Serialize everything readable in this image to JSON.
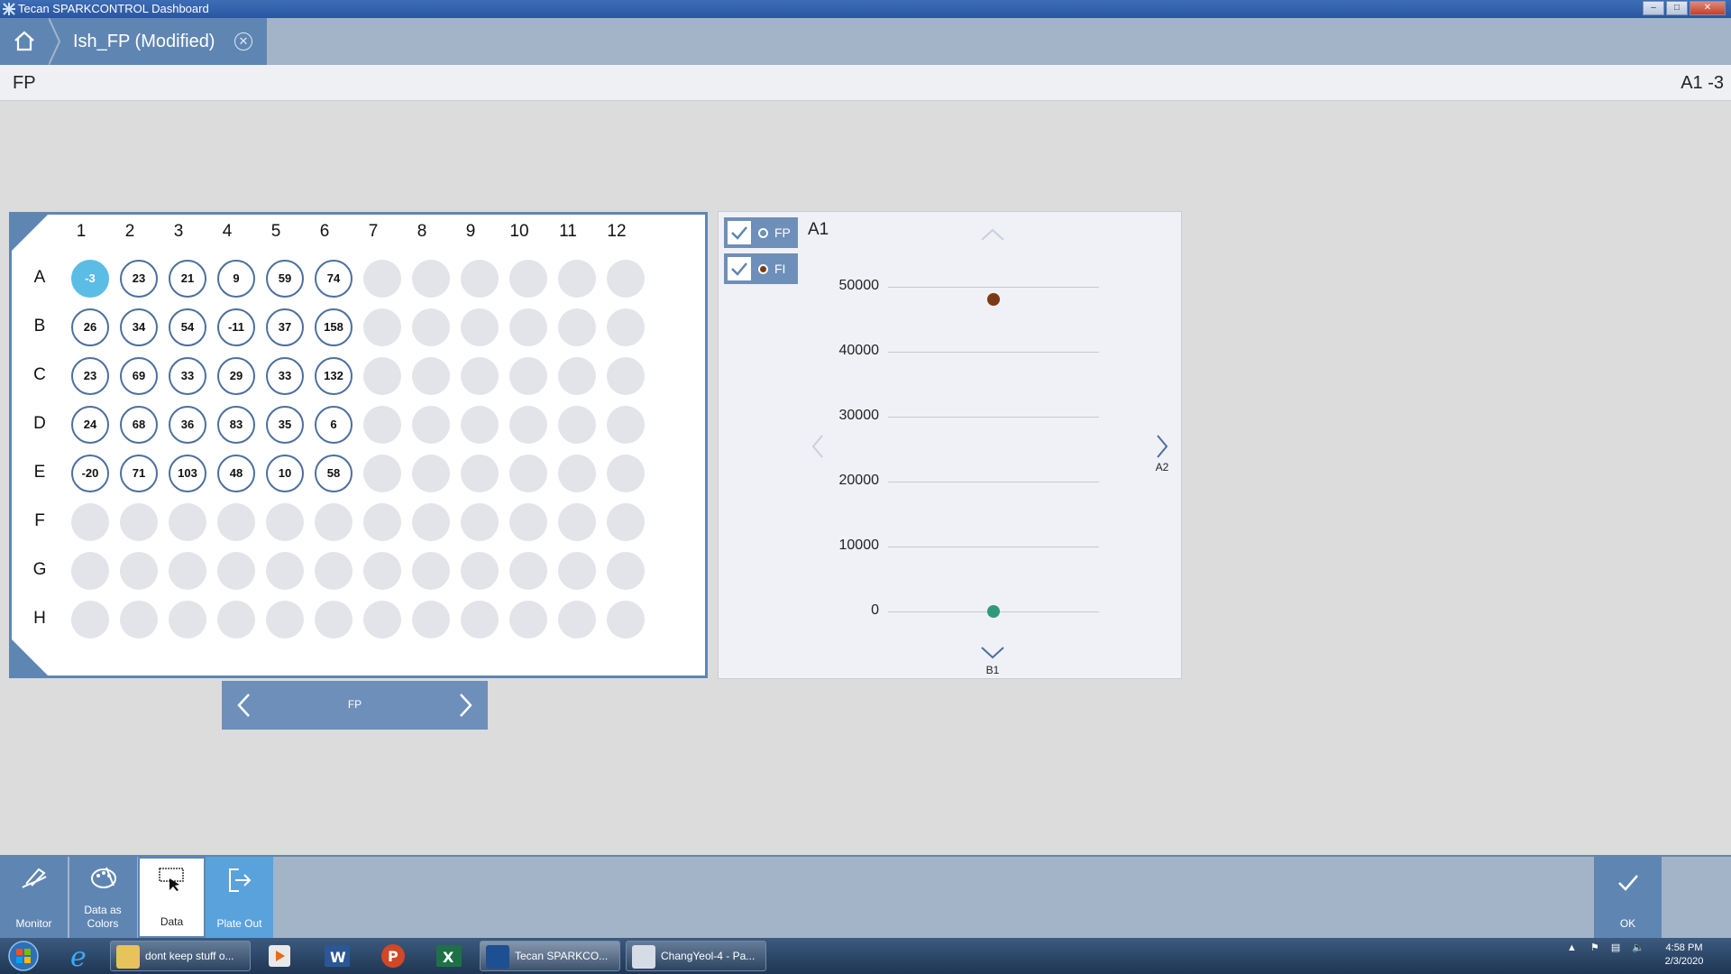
{
  "window": {
    "title": "Tecan SPARKCONTROL Dashboard"
  },
  "tab": {
    "label": "Ish_FP (Modified)"
  },
  "header": {
    "left": "FP",
    "right": "A1 -3"
  },
  "plate": {
    "columns": [
      "1",
      "2",
      "3",
      "4",
      "5",
      "6",
      "7",
      "8",
      "9",
      "10",
      "11",
      "12"
    ],
    "rows": [
      "A",
      "B",
      "C",
      "D",
      "E",
      "F",
      "G",
      "H"
    ],
    "values": [
      [
        "-3",
        "23",
        "21",
        "9",
        "59",
        "74"
      ],
      [
        "26",
        "34",
        "54",
        "-11",
        "37",
        "158"
      ],
      [
        "23",
        "69",
        "33",
        "29",
        "33",
        "132"
      ],
      [
        "24",
        "68",
        "36",
        "83",
        "35",
        "6"
      ],
      [
        "-20",
        "71",
        "103",
        "48",
        "10",
        "58"
      ]
    ],
    "selected_well": "A1",
    "nav_label": "FP"
  },
  "chart_panel": {
    "well": "A1",
    "checkboxes": [
      {
        "label": "FP",
        "checked": true,
        "color": "#2e9a7a"
      },
      {
        "label": "FI",
        "checked": true,
        "color": "#7b3a12"
      }
    ],
    "next_label": "A2",
    "down_label": "B1"
  },
  "chart_data": {
    "type": "scatter",
    "yticks": [
      "50000",
      "40000",
      "30000",
      "20000",
      "10000",
      "0"
    ],
    "ylim": [
      0,
      50000
    ],
    "series": [
      {
        "name": "FI",
        "color": "#7b3a12",
        "values": [
          48000
        ]
      },
      {
        "name": "FP",
        "color": "#2e9a7a",
        "values": [
          -3
        ]
      }
    ]
  },
  "toolbar": {
    "monitor": "Monitor",
    "data_as_colors": "Data as Colors",
    "data": "Data",
    "plate_out": "Plate Out",
    "ok": "OK"
  },
  "taskbar": {
    "items": [
      "dont keep stuff o...",
      "Tecan SPARKCO...",
      "ChangYeol-4 - Pa..."
    ],
    "time": "4:58 PM",
    "date": "2/3/2020"
  }
}
